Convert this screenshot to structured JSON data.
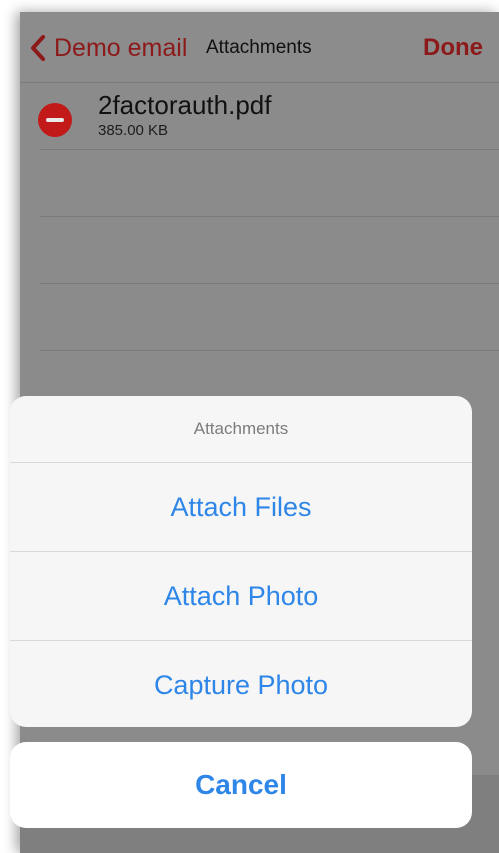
{
  "navbar": {
    "back_label": "Demo email",
    "title": "Attachments",
    "done_label": "Done",
    "accent_color": "#8d1a1a",
    "back_icon": "chevron-left-icon"
  },
  "attachments": [
    {
      "file_name": "2factorauth.pdf",
      "file_size": "385.00 KB",
      "delete_icon": "minus-circle-icon"
    }
  ],
  "action_sheet": {
    "title": "Attachments",
    "actions": [
      {
        "label": "Attach Files"
      },
      {
        "label": "Attach Photo"
      },
      {
        "label": "Capture Photo"
      }
    ],
    "action_color": "#2e86e8"
  },
  "cancel": {
    "label": "Cancel"
  }
}
